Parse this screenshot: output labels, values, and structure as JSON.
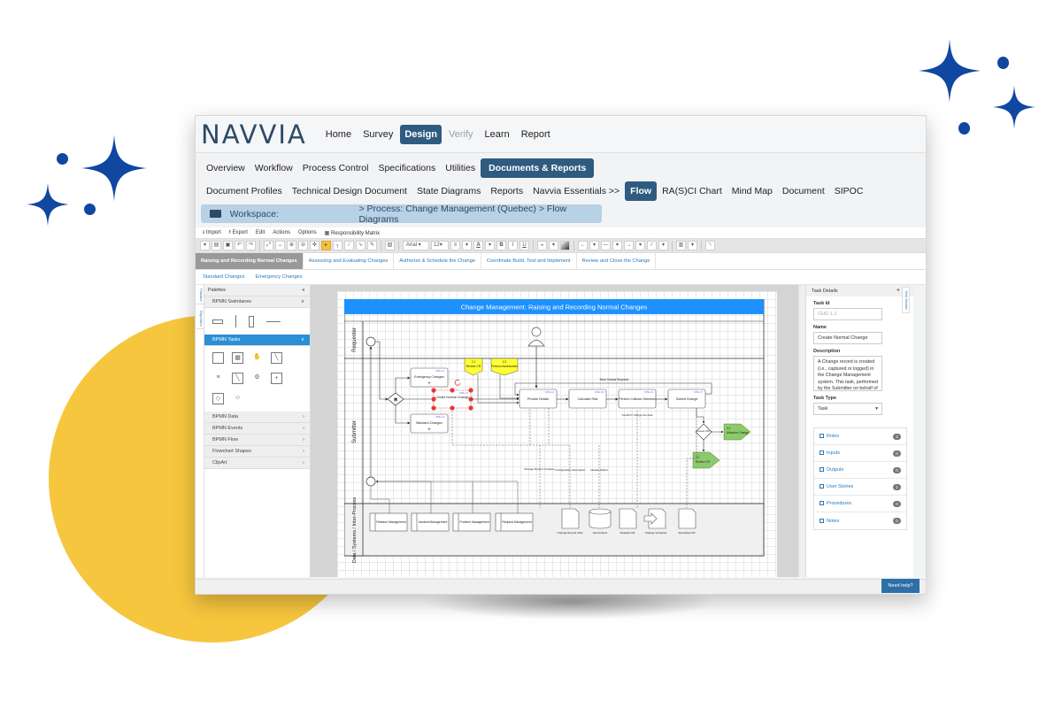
{
  "app": {
    "logo": "NAVVIA",
    "top_nav": [
      {
        "label": "Home",
        "state": "normal"
      },
      {
        "label": "Survey",
        "state": "normal"
      },
      {
        "label": "Design",
        "state": "active"
      },
      {
        "label": "Verify",
        "state": "disabled"
      },
      {
        "label": "Learn",
        "state": "normal"
      },
      {
        "label": "Report",
        "state": "normal"
      }
    ],
    "sub_nav": [
      "Overview",
      "Workflow",
      "Process Control",
      "Specifications",
      "Utilities",
      "Documents & Reports"
    ],
    "sub_nav_active": "Documents & Reports",
    "doc_nav": [
      "Document Profiles",
      "Technical Design Document",
      "State Diagrams",
      "Reports",
      "Navvia Essentials >>",
      "Flow",
      "RA(S)CI Chart",
      "Mind Map",
      "Document",
      "SIPOC"
    ],
    "doc_nav_active": "Flow",
    "workspace": {
      "label": "Workspace:",
      "path": "> Process: Change Management (Quebec) > Flow Diagrams"
    },
    "colors": {
      "brand": "#2c4a66",
      "active_nav": "#2f5b80",
      "workspace_bg": "#b7d1e6",
      "palette_selected": "#2a8fd6",
      "diagram_title": "#1e90ff",
      "annotation_yellow": "#ffff33",
      "terminator_green": "#8cc96b",
      "selection_handle": "#e53935",
      "help_button": "#2d6fa7"
    }
  },
  "menu": [
    "Import",
    "Export",
    "Edit",
    "Actions",
    "Options",
    "Responsibility Matrix"
  ],
  "toolbar": {
    "font": "Arial",
    "font_size": "12",
    "selected_tool": "pointer"
  },
  "tabs": [
    {
      "label": "Raising and Recording Normal Changes",
      "active": true
    },
    {
      "label": "Assessing and Evaluating Changes",
      "active": false
    },
    {
      "label": "Authorize & Schedule the Change",
      "active": false
    },
    {
      "label": "Coordinate Build, Test and Implement",
      "active": false
    },
    {
      "label": "Review and Close the Change",
      "active": false
    }
  ],
  "sub_tabs": [
    "Standard Changes",
    "Emergency Changes"
  ],
  "side_tabs": [
    "Palettes",
    "Reporters"
  ],
  "palette": {
    "title": "Palettes",
    "sections": [
      {
        "label": "BPMN Swimlanes",
        "state": "expanded"
      },
      {
        "label": "BPMN Tasks",
        "state": "selected"
      },
      {
        "label": "BPMN Data",
        "state": "collapsed"
      },
      {
        "label": "BPMN Events",
        "state": "collapsed"
      },
      {
        "label": "BPMN Flow",
        "state": "collapsed"
      },
      {
        "label": "Flowchart Shapes",
        "state": "collapsed"
      },
      {
        "label": "ClipArt",
        "state": "collapsed"
      }
    ]
  },
  "diagram": {
    "title": "Change Management: Raising and Recording Normal Changes",
    "lanes": [
      "Requester",
      "Submitter",
      "Data / Systems / Inter-Process"
    ],
    "tasks": {
      "emergency": {
        "label": "Emergency Changes",
        "id": "CHG 1.3"
      },
      "create": {
        "label": "Create Normal Change",
        "id": "CHG 1.1"
      },
      "standard": {
        "label": "Standard Changes",
        "id": "CHG 1.2"
      },
      "provide": {
        "label": "Provide Details",
        "id": "CHG 1.4"
      },
      "calculate": {
        "label": "Calculate Risk",
        "id": "CHG 1.5"
      },
      "collision": {
        "label": "Perform Collision Detection",
        "id": "CHG 1.6"
      },
      "submit": {
        "label": "Submit Change",
        "id": "CHG 1.7"
      }
    },
    "annotations": [
      {
        "number": "2.1",
        "label": "Review CR"
      },
      {
        "number": "2.2",
        "label": "Perform Assessment"
      }
    ],
    "loop_label": "More Details Required",
    "gateway_label": "Cancel CR?",
    "terminators": [
      {
        "number": "3.1",
        "label": "Abandon Change"
      },
      {
        "number": "2.1",
        "label": "Review CR"
      }
    ],
    "flow_labels": {
      "conflict": "Conflict? change the date",
      "record_created": "Change Record Created",
      "config_info": "Configuration Information",
      "details_added": "Details Added"
    },
    "processes": [
      "Release Management",
      "Incident Management",
      "Problem Management",
      "Request Management"
    ],
    "data_objects": [
      "Change Record (CR)",
      "ServiceNow",
      "Detailed CR",
      "Change Schedule",
      "Submitted CR"
    ]
  },
  "task_details": {
    "title": "Task Details",
    "side_tab": "Task Details",
    "task_id_label": "Task Id",
    "task_id": "CHG 1.1",
    "name_label": "Name",
    "name": "Create Normal Change",
    "description_label": "Description",
    "description": "A Change record is created (i.e., captured or logged) in the Change Management system.  This task, performed by the Submitter on behalf of the Requester, includes",
    "task_type_label": "Task Type",
    "task_type": "Task",
    "links": [
      {
        "label": "Roles",
        "count": "3"
      },
      {
        "label": "Inputs",
        "count": "0"
      },
      {
        "label": "Outputs",
        "count": "0"
      },
      {
        "label": "User Stories",
        "count": "1"
      },
      {
        "label": "Procedures",
        "count": "0"
      },
      {
        "label": "Notes",
        "count": "0"
      }
    ]
  },
  "help_button": "Need help?"
}
